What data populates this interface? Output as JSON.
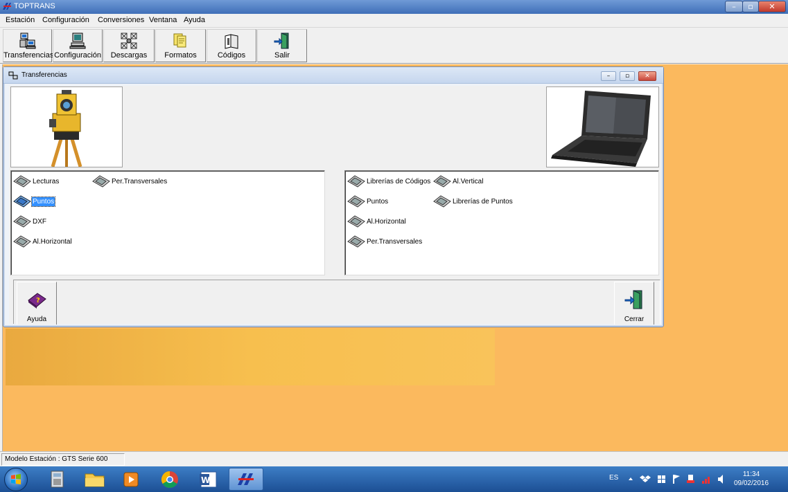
{
  "window": {
    "title": "TOPTRANS",
    "minimize": "–",
    "maximize": "▫",
    "close": "✕"
  },
  "menu": [
    "Estación",
    "Configuración",
    "Conversiones",
    "Ventana",
    "Ayuda"
  ],
  "toolbar": [
    "Transferencias",
    "Configuración",
    "Descargas",
    "Formatos",
    "Códigos",
    "Salir"
  ],
  "transfer_window": {
    "title": "Transferencias",
    "minimize": "–",
    "maximize": "▫",
    "close": "✕",
    "left_list": [
      "Lecturas",
      "Per.Transversales",
      "Puntos",
      "DXF",
      "Al.Horizontal"
    ],
    "left_selected": "Puntos",
    "right_list": [
      "Librerías de Códigos",
      "Al.Vertical",
      "Puntos",
      "Librerías de Puntos",
      "Al.Horizontal",
      "Per.Transversales"
    ],
    "help_button": "Ayuda",
    "close_button": "Cerrar"
  },
  "status": {
    "model": "Modelo Estación : GTS Serie 600"
  },
  "taskbar": {
    "language": "ES",
    "time": "11:34",
    "date": "09/02/2016"
  },
  "colors": {
    "desktop": "#fbb95e",
    "selection": "#3390ff",
    "taskbar": "#1c4f94"
  }
}
